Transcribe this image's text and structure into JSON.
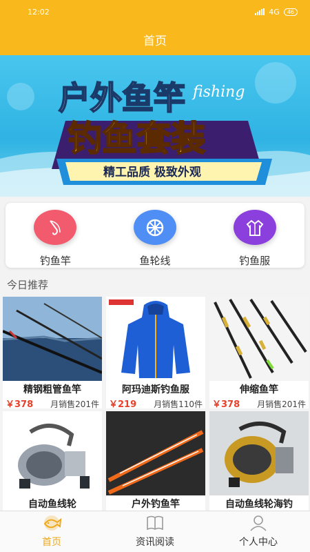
{
  "status": {
    "time": "12:02",
    "network": "4G",
    "battery": "46"
  },
  "header": {
    "title": "首页"
  },
  "banner": {
    "line1": "户外鱼竿",
    "line1_en": "fishing",
    "line2": "钓鱼套装",
    "slogan": "精工品质 极致外观"
  },
  "categories": [
    {
      "label": "钓鱼竿",
      "icon": "fishing-rod-icon",
      "color": "#f25a6e"
    },
    {
      "label": "鱼轮线",
      "icon": "reel-wheel-icon",
      "color": "#4f8ef5"
    },
    {
      "label": "钓鱼服",
      "icon": "jacket-icon",
      "color": "#8b3fdc"
    }
  ],
  "section": {
    "title": "今日推荐"
  },
  "products": [
    {
      "name": "精钢粗管鱼竿",
      "price": "￥378",
      "sales": "月销售201件"
    },
    {
      "name": "阿玛迪斯钓鱼服",
      "price": "￥219",
      "sales": "月销售110件"
    },
    {
      "name": "伸缩鱼竿",
      "price": "￥378",
      "sales": "月销售201件"
    },
    {
      "name": "自动鱼线轮",
      "price": "",
      "sales": ""
    },
    {
      "name": "户外钓鱼竿",
      "price": "",
      "sales": ""
    },
    {
      "name": "自动鱼线轮海钓",
      "price": "",
      "sales": ""
    }
  ],
  "tabs": [
    {
      "label": "首页",
      "icon": "fish-home-icon",
      "active": true
    },
    {
      "label": "资讯阅读",
      "icon": "book-icon",
      "active": false
    },
    {
      "label": "个人中心",
      "icon": "person-icon",
      "active": false
    }
  ],
  "colors": {
    "brand": "#f9b81c",
    "price": "#e7402b",
    "active_tab": "#f0a81a"
  }
}
